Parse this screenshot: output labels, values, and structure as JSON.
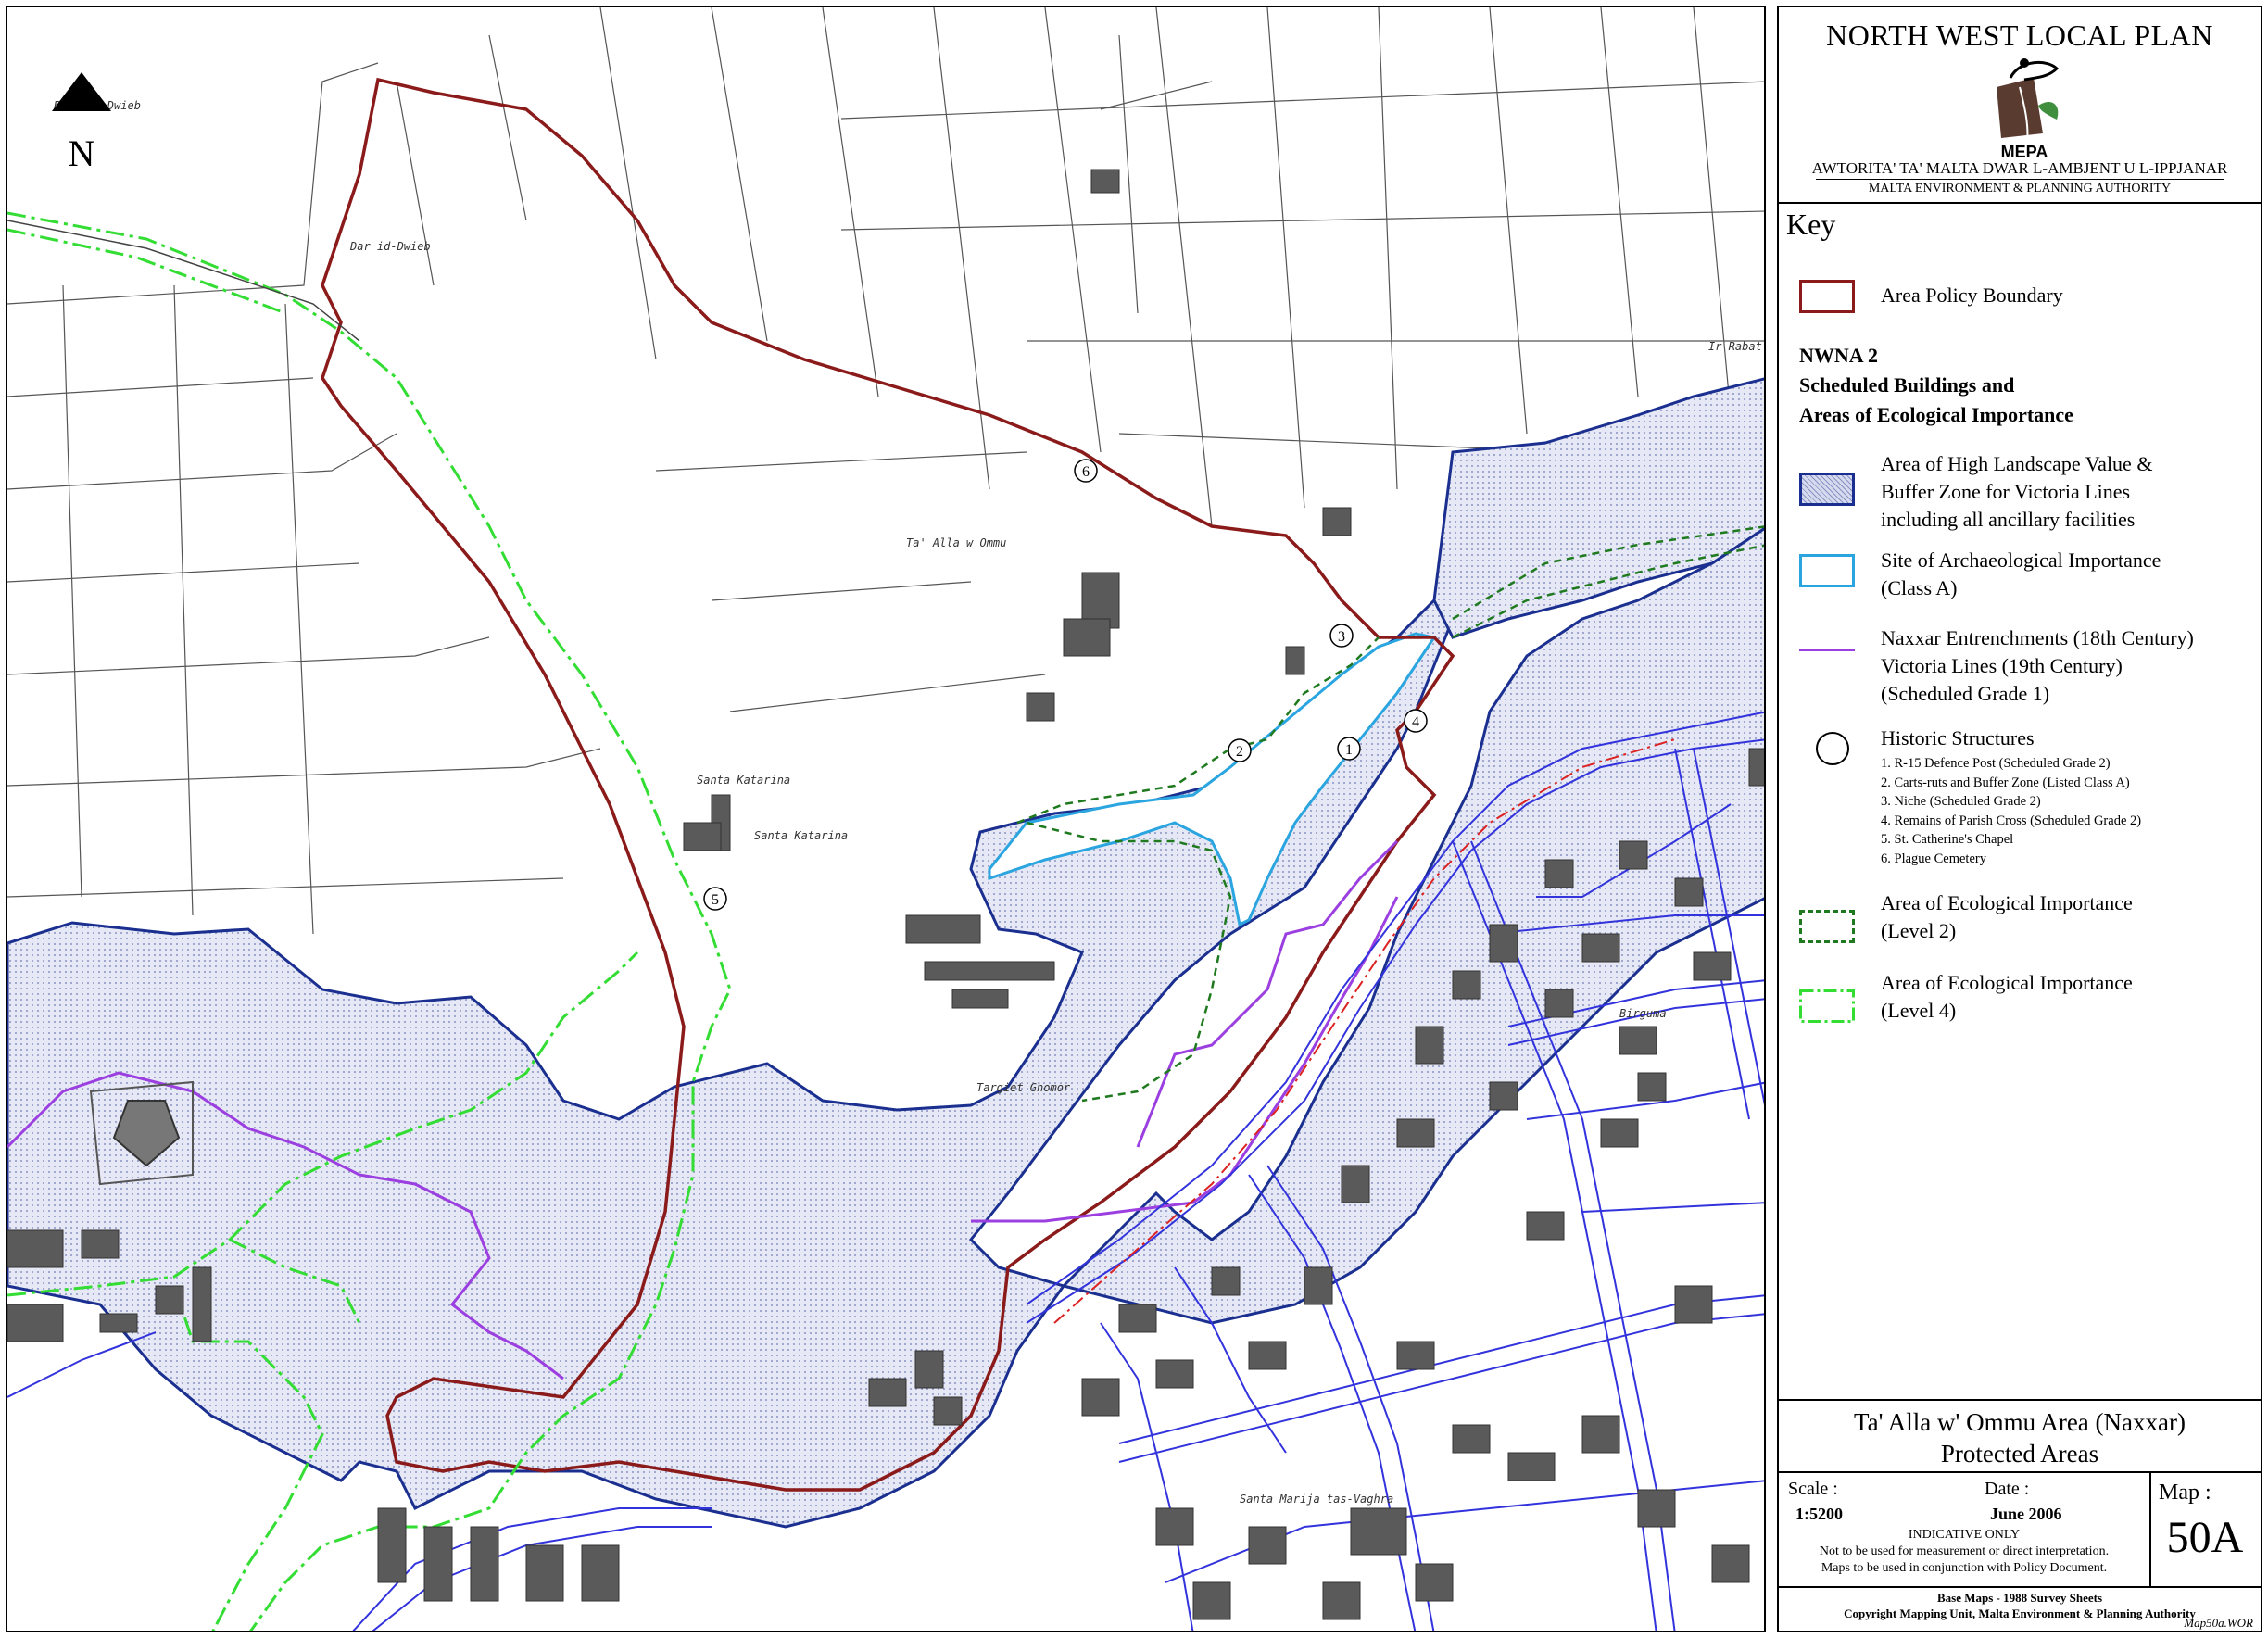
{
  "header": {
    "plan_title": "NORTH WEST LOCAL PLAN",
    "logo_text": "MEPA",
    "authority_mt": "AWTORITA' TA' MALTA DWAR L-AMBJENT U L-IPPJANAR",
    "authority_en": "MALTA ENVIRONMENT & PLANNING AUTHORITY"
  },
  "key": {
    "title": "Key",
    "boundary": "Area Policy Boundary",
    "section_heading": [
      "NWNA 2",
      "Scheduled Buildings and",
      "Areas of Ecological Importance"
    ],
    "items": [
      {
        "label": [
          "Area of High Landscape Value &",
          "Buffer Zone for Victoria Lines",
          "including all ancillary facilities"
        ],
        "color": "#1a2f8f"
      },
      {
        "label": [
          "Site of Archaeological Importance",
          "(Class A)"
        ],
        "color": "#2aa5e0"
      },
      {
        "label": [
          "Naxxar Entrenchments (18th Century)",
          "Victoria Lines (19th Century)",
          "(Scheduled Grade 1)"
        ],
        "color": "#9b3fe0"
      },
      {
        "label": [
          "Historic Structures"
        ],
        "color": "#000000"
      },
      {
        "label": [
          "Area of Ecological Importance",
          "(Level 2)"
        ],
        "color": "#1f7a1f"
      },
      {
        "label": [
          "Area of Ecological Importance",
          "(Level 4)"
        ],
        "color": "#33dd33"
      }
    ],
    "historic_structures": [
      "1. R-15 Defence Post (Scheduled Grade 2)",
      "2. Carts-ruts and Buffer Zone (Listed Class A)",
      "3. Niche (Scheduled Grade 2)",
      "4. Remains of Parish Cross (Scheduled Grade 2)",
      "5. St. Catherine's Chapel",
      "6. Plague Cemetery"
    ]
  },
  "map_title": [
    "Ta' Alla w' Ommu Area (Naxxar)",
    "Protected Areas"
  ],
  "info": {
    "scale_label": "Scale :",
    "scale_value": "1:5200",
    "date_label": "Date :",
    "date_value": "June 2006",
    "map_label": "Map :",
    "map_value": "50A",
    "notes": [
      "INDICATIVE ONLY",
      "Not to be used for measurement or direct interpretation.",
      "Maps to be used in conjunction with Policy Document."
    ]
  },
  "footer": {
    "lines": [
      "Base Maps - 1988 Survey Sheets",
      "Copyright Mapping Unit, Malta Environment & Planning Authority"
    ],
    "file": "Map50a.WOR"
  },
  "map": {
    "north": "N",
    "place_labels": [
      "Dar id-Dwieb",
      "Ta' Alla w Ommu",
      "Santa Katarina",
      "Santa Katarina",
      "Targiet Ghomor",
      "Birguma",
      "Santa Marija tas-Vaghra",
      "Ir-Rabat San Piet",
      "Bieb id-Dwieb"
    ],
    "markers": [
      "1",
      "2",
      "3",
      "4",
      "5",
      "6"
    ],
    "colors": {
      "boundary": "#8b1a1a",
      "landscape": "#1a2f8f",
      "archaeology": "#2aa5e0",
      "entrenchment": "#9b3fe0",
      "eco2": "#1f7a1f",
      "eco4": "#33dd33",
      "roads": "#3333dd",
      "buildings": "#5a5a5a"
    }
  }
}
